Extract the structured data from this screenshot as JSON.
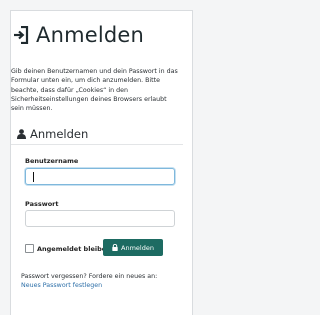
{
  "page": {
    "title": "Anmelden",
    "intro": "Gib deinen Benutzernamen und dein Passwort in das Formular unten ein, um dich anzumelden. Bitte beachte, dass dafür „Cookies“ in den Sicherheitseinstellungen deines Browsers erlaubt sein müssen.",
    "title_icon": "sign-in-icon"
  },
  "form": {
    "heading": "Anmelden",
    "heading_icon": "user-icon",
    "username_label": "Benutzername",
    "username_value": "",
    "password_label": "Passwort",
    "password_value": "",
    "remember_label": "Angemeldet bleiben",
    "remember_checked": false,
    "submit_label": "Anmelden",
    "submit_icon": "lock-icon",
    "submit_color": "#1d6b62"
  },
  "footer": {
    "forgot_text": "Passwort vergessen? Fordere ein neues an:",
    "reset_link": "Neues Passwort festlegen",
    "link_color": "#2d6fa8"
  }
}
